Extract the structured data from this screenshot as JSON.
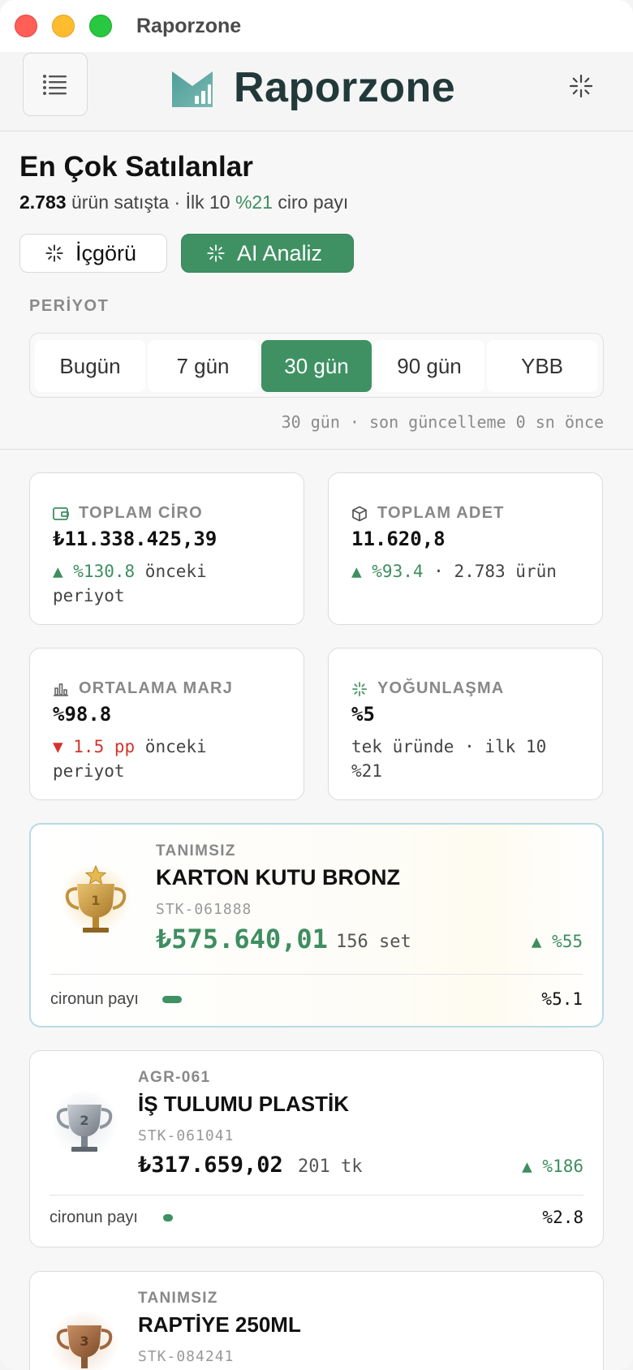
{
  "window": {
    "title": "Raporzone"
  },
  "header": {
    "brand": "Raporzone"
  },
  "section": {
    "title": "En Çok Satılanlar",
    "product_count": "2.783",
    "subtitle_mid": "ürün satışta · İlk 10",
    "top10_share": "%21",
    "subtitle_end": "ciro payı"
  },
  "actions": {
    "insight_label": "İçgörü",
    "ai_label": "AI Analiz"
  },
  "period": {
    "label": "PERİYOT",
    "options": [
      "Bugün",
      "7 gün",
      "30 gün",
      "90 gün",
      "YBB"
    ],
    "selected": "30 gün",
    "update_note": "30 gün · son güncelleme 0 sn önce"
  },
  "kpis": [
    {
      "label": "TOPLAM CİRO",
      "icon": "wallet-icon",
      "value": "₺11.338.425,39",
      "delta": "▲ %130.8",
      "note": " önceki periyot"
    },
    {
      "label": "TOPLAM ADET",
      "icon": "box-icon",
      "value": "11.620,8",
      "delta": "▲ %93.4",
      "note": " · 2.783 ürün"
    },
    {
      "label": "ORTALAMA MARJ",
      "icon": "bar-chart-icon",
      "value": "%98.8",
      "delta": "▼ 1.5 pp",
      "note": " önceki periyot"
    },
    {
      "label": "YOĞUNLAŞMA",
      "icon": "sparkle-icon",
      "value": "%5",
      "delta": "",
      "note": "tek üründe · ilk 10 %21"
    }
  ],
  "ranking": [
    {
      "rank": "1",
      "category": "TANIMSIZ",
      "name": "KARTON KUTU BRONZ",
      "sku": "STK-061888",
      "amount": "₺575.640,01",
      "qty": "156 set",
      "growth": "▲ %55",
      "share_label": "cironun payı",
      "share": "%5.1",
      "share_fraction": 0.051
    },
    {
      "rank": "2",
      "category": "AGR-061",
      "name": "İŞ TULUMU PLASTİK",
      "sku": "STK-061041",
      "amount": "₺317.659,02",
      "qty": "201 tk",
      "growth": "▲ %186",
      "share_label": "cironun payı",
      "share": "%2.8",
      "share_fraction": 0.028
    },
    {
      "rank": "3",
      "category": "TANIMSIZ",
      "name": "RAPTİYE 250ML",
      "sku": "STK-084241"
    }
  ],
  "colors": {
    "accent": "#3f9163",
    "down": "#d3342b",
    "gold": "#c9962e",
    "silver": "#8d959e",
    "bronze": "#a0683f"
  }
}
